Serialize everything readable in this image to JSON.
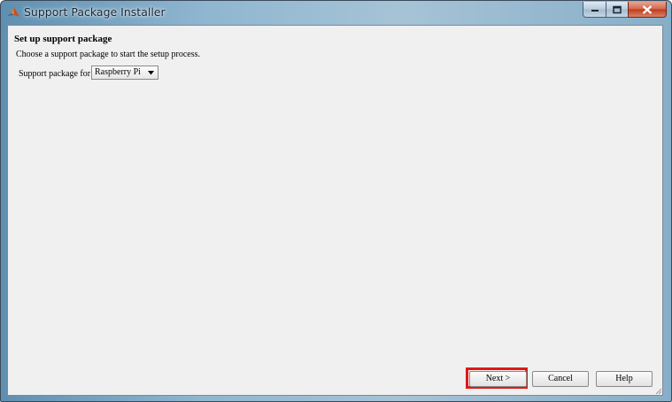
{
  "window": {
    "title": "Support Package Installer",
    "app_icon": "matlab-logo-icon",
    "controls": {
      "minimize": "minimize-icon",
      "maximize": "maximize-icon",
      "close": "close-icon"
    }
  },
  "page": {
    "heading": "Set up support package",
    "description": "Choose a support package to start the setup process.",
    "package_label": "Support package for:",
    "package_select": {
      "value": "Raspberry Pi",
      "icon": "dropdown-arrow-icon"
    }
  },
  "buttons": {
    "next": "Next >",
    "cancel": "Cancel",
    "help": "Help"
  },
  "annotation": {
    "highlight_color": "#e01818",
    "target": "next"
  },
  "colors": {
    "client_bg": "#f0f0f0",
    "titlebar_accent": "#8fb6d0",
    "close_button": "#c0391b"
  }
}
